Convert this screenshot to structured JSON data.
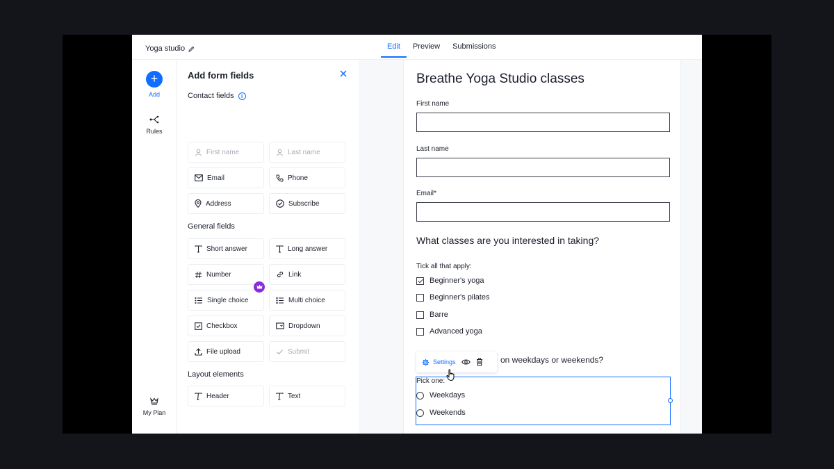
{
  "topbar": {
    "site_name": "Yoga studio",
    "tabs": [
      {
        "label": "Edit",
        "active": true
      },
      {
        "label": "Preview",
        "active": false
      },
      {
        "label": "Submissions",
        "active": false
      }
    ]
  },
  "rail": {
    "add_label": "Add",
    "add_glyph": "+",
    "rules_label": "Rules",
    "plan_label": "My Plan"
  },
  "panel": {
    "title": "Add form fields",
    "contact_title": "Contact fields",
    "general_title": "General fields",
    "layout_title": "Layout elements",
    "contact_fields": [
      {
        "label": "First name",
        "icon": "person-icon",
        "disabled": true
      },
      {
        "label": "Last name",
        "icon": "person-icon",
        "disabled": true
      },
      {
        "label": "Email",
        "icon": "envelope-icon",
        "disabled": false
      },
      {
        "label": "Phone",
        "icon": "phone-icon",
        "disabled": false
      },
      {
        "label": "Address",
        "icon": "location-pin-icon",
        "disabled": false
      },
      {
        "label": "Subscribe",
        "icon": "check-circle-icon",
        "disabled": false
      }
    ],
    "general_fields": [
      {
        "label": "Short answer",
        "icon": "text-icon"
      },
      {
        "label": "Long answer",
        "icon": "text-icon"
      },
      {
        "label": "Number",
        "icon": "hash-icon"
      },
      {
        "label": "Link",
        "icon": "link-icon"
      },
      {
        "label": "Single choice",
        "icon": "list-icon"
      },
      {
        "label": "Multi choice",
        "icon": "checklist-icon"
      },
      {
        "label": "Checkbox",
        "icon": "checkbox-icon"
      },
      {
        "label": "Dropdown",
        "icon": "dropdown-icon"
      },
      {
        "label": "File upload",
        "icon": "upload-icon",
        "premium": true
      },
      {
        "label": "Submit",
        "icon": "check-icon",
        "disabled": true
      }
    ],
    "layout_fields": [
      {
        "label": "Header",
        "icon": "header-icon"
      },
      {
        "label": "Text",
        "icon": "text-icon"
      }
    ]
  },
  "form": {
    "title": "Breathe Yoga Studio classes",
    "first_name_label": "First name",
    "last_name_label": "Last name",
    "email_label": "Email*",
    "question1": "What classes are you interested in taking?",
    "q1_hint": "Tick all that apply:",
    "q1_options": [
      {
        "label": "Beginner's yoga",
        "checked": true
      },
      {
        "label": "Beginner's pilates",
        "checked": false
      },
      {
        "label": "Barre",
        "checked": false
      },
      {
        "label": "Advanced yoga",
        "checked": false
      }
    ],
    "question2_visible": "on weekdays or weekends?",
    "q2_hint": "Pick one:",
    "q2_options": [
      "Weekdays",
      "Weekends"
    ],
    "toolbar_settings": "Settings"
  },
  "colors": {
    "accent": "#116dff",
    "premium": "#8b2bd9"
  }
}
